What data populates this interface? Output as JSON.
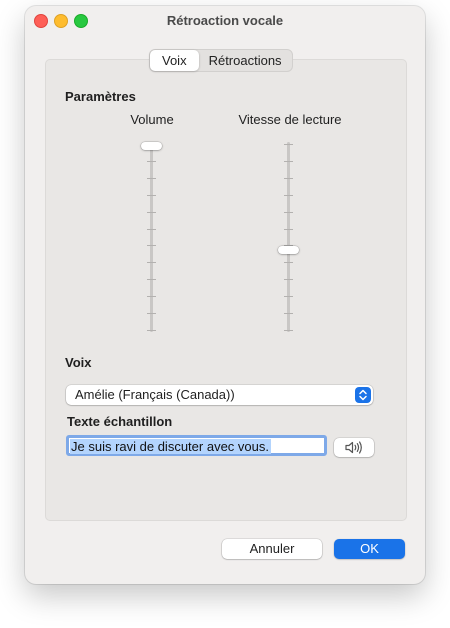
{
  "window": {
    "title": "Rétroaction vocale"
  },
  "tabs": [
    {
      "label": "Voix",
      "active": true
    },
    {
      "label": "Rétroactions",
      "active": false
    }
  ],
  "settings": {
    "heading": "Paramètres",
    "volume": {
      "label": "Volume",
      "level": 1.0
    },
    "rate": {
      "label": "Vitesse de lecture",
      "level": 0.43
    }
  },
  "voice": {
    "heading": "Voix",
    "selected": "Amélie (Français (Canada))"
  },
  "sample": {
    "heading": "Texte échantillon",
    "value": "Je suis ravi de discuter avec vous."
  },
  "buttons": {
    "cancel": "Annuler",
    "ok": "OK"
  },
  "colors": {
    "accent": "#1a73e8",
    "selection": "#b3d4fd"
  },
  "icons": {
    "speak": "speaker-icon",
    "stepper": "up-down-chevron-icon"
  }
}
